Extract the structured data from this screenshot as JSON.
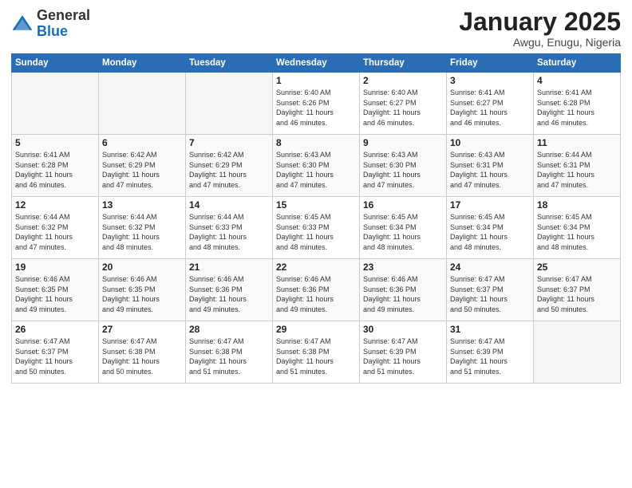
{
  "header": {
    "logo_general": "General",
    "logo_blue": "Blue",
    "month_year": "January 2025",
    "location": "Awgu, Enugu, Nigeria"
  },
  "days_of_week": [
    "Sunday",
    "Monday",
    "Tuesday",
    "Wednesday",
    "Thursday",
    "Friday",
    "Saturday"
  ],
  "weeks": [
    [
      {
        "day": "",
        "info": ""
      },
      {
        "day": "",
        "info": ""
      },
      {
        "day": "",
        "info": ""
      },
      {
        "day": "1",
        "info": "Sunrise: 6:40 AM\nSunset: 6:26 PM\nDaylight: 11 hours\nand 46 minutes."
      },
      {
        "day": "2",
        "info": "Sunrise: 6:40 AM\nSunset: 6:27 PM\nDaylight: 11 hours\nand 46 minutes."
      },
      {
        "day": "3",
        "info": "Sunrise: 6:41 AM\nSunset: 6:27 PM\nDaylight: 11 hours\nand 46 minutes."
      },
      {
        "day": "4",
        "info": "Sunrise: 6:41 AM\nSunset: 6:28 PM\nDaylight: 11 hours\nand 46 minutes."
      }
    ],
    [
      {
        "day": "5",
        "info": "Sunrise: 6:41 AM\nSunset: 6:28 PM\nDaylight: 11 hours\nand 46 minutes."
      },
      {
        "day": "6",
        "info": "Sunrise: 6:42 AM\nSunset: 6:29 PM\nDaylight: 11 hours\nand 47 minutes."
      },
      {
        "day": "7",
        "info": "Sunrise: 6:42 AM\nSunset: 6:29 PM\nDaylight: 11 hours\nand 47 minutes."
      },
      {
        "day": "8",
        "info": "Sunrise: 6:43 AM\nSunset: 6:30 PM\nDaylight: 11 hours\nand 47 minutes."
      },
      {
        "day": "9",
        "info": "Sunrise: 6:43 AM\nSunset: 6:30 PM\nDaylight: 11 hours\nand 47 minutes."
      },
      {
        "day": "10",
        "info": "Sunrise: 6:43 AM\nSunset: 6:31 PM\nDaylight: 11 hours\nand 47 minutes."
      },
      {
        "day": "11",
        "info": "Sunrise: 6:44 AM\nSunset: 6:31 PM\nDaylight: 11 hours\nand 47 minutes."
      }
    ],
    [
      {
        "day": "12",
        "info": "Sunrise: 6:44 AM\nSunset: 6:32 PM\nDaylight: 11 hours\nand 47 minutes."
      },
      {
        "day": "13",
        "info": "Sunrise: 6:44 AM\nSunset: 6:32 PM\nDaylight: 11 hours\nand 48 minutes."
      },
      {
        "day": "14",
        "info": "Sunrise: 6:44 AM\nSunset: 6:33 PM\nDaylight: 11 hours\nand 48 minutes."
      },
      {
        "day": "15",
        "info": "Sunrise: 6:45 AM\nSunset: 6:33 PM\nDaylight: 11 hours\nand 48 minutes."
      },
      {
        "day": "16",
        "info": "Sunrise: 6:45 AM\nSunset: 6:34 PM\nDaylight: 11 hours\nand 48 minutes."
      },
      {
        "day": "17",
        "info": "Sunrise: 6:45 AM\nSunset: 6:34 PM\nDaylight: 11 hours\nand 48 minutes."
      },
      {
        "day": "18",
        "info": "Sunrise: 6:45 AM\nSunset: 6:34 PM\nDaylight: 11 hours\nand 48 minutes."
      }
    ],
    [
      {
        "day": "19",
        "info": "Sunrise: 6:46 AM\nSunset: 6:35 PM\nDaylight: 11 hours\nand 49 minutes."
      },
      {
        "day": "20",
        "info": "Sunrise: 6:46 AM\nSunset: 6:35 PM\nDaylight: 11 hours\nand 49 minutes."
      },
      {
        "day": "21",
        "info": "Sunrise: 6:46 AM\nSunset: 6:36 PM\nDaylight: 11 hours\nand 49 minutes."
      },
      {
        "day": "22",
        "info": "Sunrise: 6:46 AM\nSunset: 6:36 PM\nDaylight: 11 hours\nand 49 minutes."
      },
      {
        "day": "23",
        "info": "Sunrise: 6:46 AM\nSunset: 6:36 PM\nDaylight: 11 hours\nand 49 minutes."
      },
      {
        "day": "24",
        "info": "Sunrise: 6:47 AM\nSunset: 6:37 PM\nDaylight: 11 hours\nand 50 minutes."
      },
      {
        "day": "25",
        "info": "Sunrise: 6:47 AM\nSunset: 6:37 PM\nDaylight: 11 hours\nand 50 minutes."
      }
    ],
    [
      {
        "day": "26",
        "info": "Sunrise: 6:47 AM\nSunset: 6:37 PM\nDaylight: 11 hours\nand 50 minutes."
      },
      {
        "day": "27",
        "info": "Sunrise: 6:47 AM\nSunset: 6:38 PM\nDaylight: 11 hours\nand 50 minutes."
      },
      {
        "day": "28",
        "info": "Sunrise: 6:47 AM\nSunset: 6:38 PM\nDaylight: 11 hours\nand 51 minutes."
      },
      {
        "day": "29",
        "info": "Sunrise: 6:47 AM\nSunset: 6:38 PM\nDaylight: 11 hours\nand 51 minutes."
      },
      {
        "day": "30",
        "info": "Sunrise: 6:47 AM\nSunset: 6:39 PM\nDaylight: 11 hours\nand 51 minutes."
      },
      {
        "day": "31",
        "info": "Sunrise: 6:47 AM\nSunset: 6:39 PM\nDaylight: 11 hours\nand 51 minutes."
      },
      {
        "day": "",
        "info": ""
      }
    ]
  ]
}
